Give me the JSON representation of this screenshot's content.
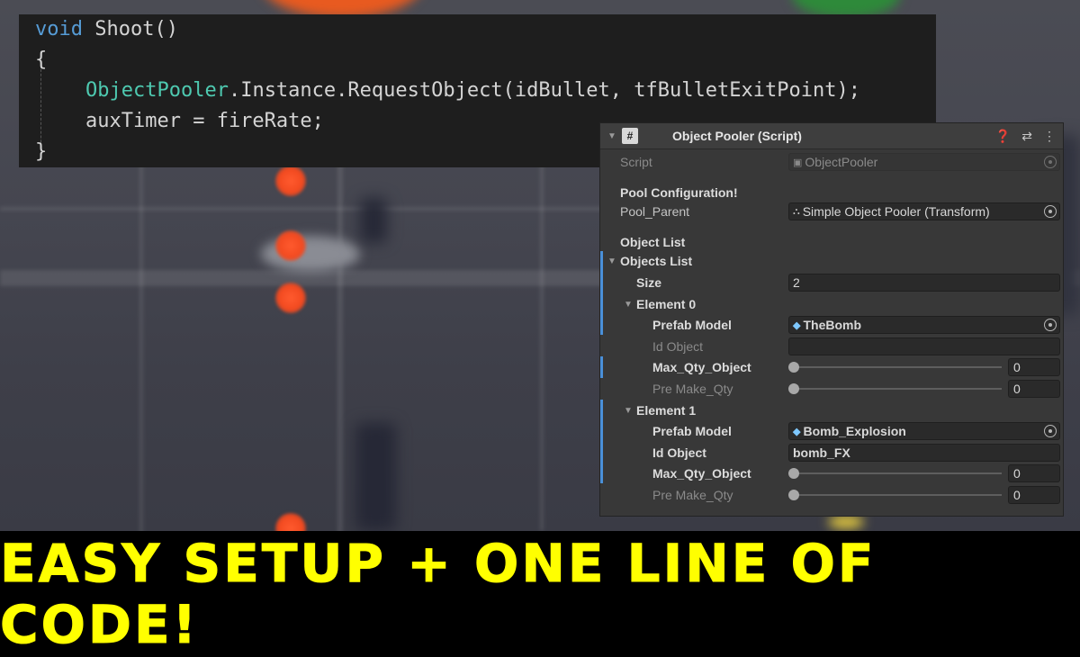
{
  "code": {
    "lines": [
      {
        "keyword": "void",
        "rest": " Shoot()"
      },
      {
        "text": "{"
      },
      {
        "type": "ObjectPooler",
        "rest": ".Instance.RequestObject(idBullet, tfBulletExitPoint);"
      },
      {
        "text": "auxTimer = fireRate;"
      },
      {
        "text": "}"
      }
    ]
  },
  "inspector": {
    "title": "Object Pooler (Script)",
    "header_icons": [
      "help-icon",
      "presets-icon",
      "menu-icon"
    ],
    "script_label": "Script",
    "script_value": "ObjectPooler",
    "pool_config_heading": "Pool Configuration!",
    "pool_parent_label": "Pool_Parent",
    "pool_parent_value": "Simple Object Pooler (Transform)",
    "object_list_heading": "Object List",
    "objects_list_label": "Objects List",
    "size_label": "Size",
    "size_value": "2",
    "elements": [
      {
        "label": "Element 0",
        "prefab_label": "Prefab Model",
        "prefab_value": "TheBomb",
        "id_label": "Id Object",
        "id_value": "",
        "max_label": "Max_Qty_Object",
        "max_value": "0",
        "pre_label": "Pre Make_Qty",
        "pre_value": "0"
      },
      {
        "label": "Element 1",
        "prefab_label": "Prefab Model",
        "prefab_value": "Bomb_Explosion",
        "id_label": "Id Object",
        "id_value": "bomb_FX",
        "max_label": "Max_Qty_Object",
        "max_value": "0",
        "pre_label": "Pre Make_Qty",
        "pre_value": "0"
      }
    ]
  },
  "banner": {
    "text": "Easy Setup + One Line of Code!",
    "color": "#ffff00"
  }
}
